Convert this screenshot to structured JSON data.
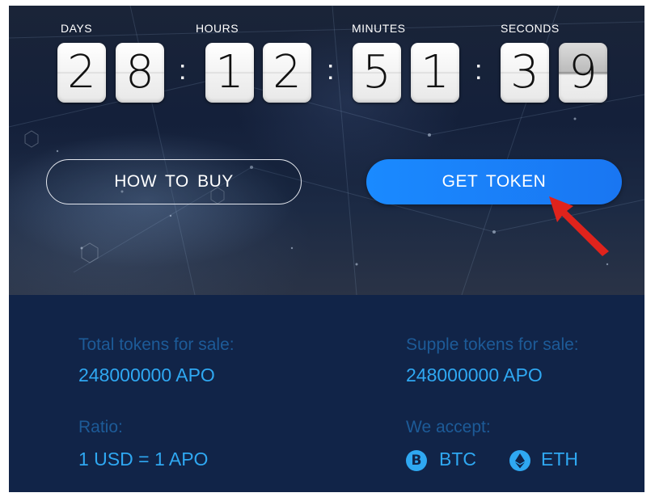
{
  "countdown": {
    "labels": {
      "days": "DAYS",
      "hours": "HOURS",
      "minutes": "MINUTES",
      "seconds": "SECONDS"
    },
    "digits": {
      "days": [
        "2",
        "8"
      ],
      "hours": [
        "1",
        "2"
      ],
      "minutes": [
        "5",
        "1"
      ],
      "seconds": [
        "3",
        "9"
      ]
    },
    "separator": ":"
  },
  "buttons": {
    "how_to_buy": "HOW TO BUY",
    "get_token": "GET TOKEN"
  },
  "info": {
    "total_label": "Total tokens for sale:",
    "total_value": "248000000 APO",
    "supple_label": "Supple tokens for sale:",
    "supple_value": "248000000 APO",
    "ratio_label": "Ratio:",
    "ratio_value": "1 USD = 1 APO",
    "accept_label": "We accept:",
    "currencies": [
      {
        "symbol": "B",
        "name": "BTC",
        "icon": "bitcoin-icon"
      },
      {
        "symbol": "",
        "name": "ETH",
        "icon": "ethereum-icon"
      }
    ]
  },
  "colors": {
    "accent": "#2fa8f2",
    "button": "#1a8aff",
    "arrow": "#e0231c",
    "panel": "#112448",
    "muted_label": "#1d5b98"
  }
}
